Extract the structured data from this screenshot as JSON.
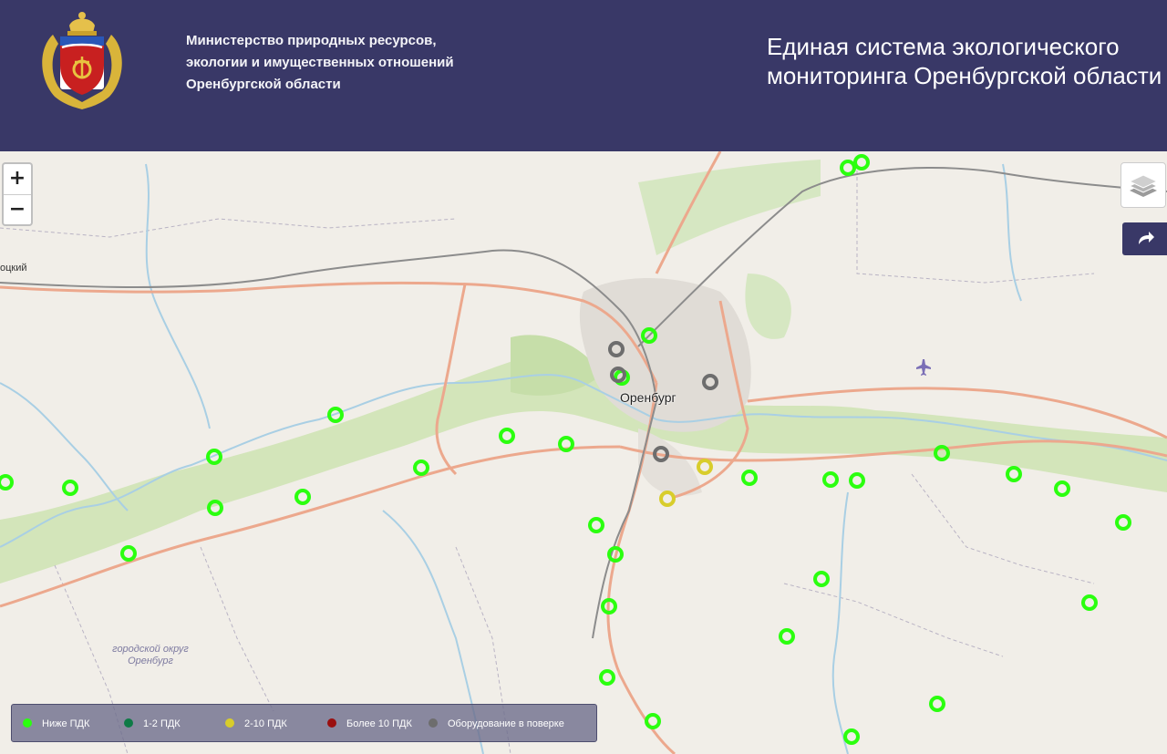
{
  "header": {
    "ministry_line1": "Министерство природных ресурсов,",
    "ministry_line2": "экологии и имущественных отношений",
    "ministry_line3": "Оренбургской области",
    "title_line1": "Единая система экологического",
    "title_line2": "мониторинга Оренбургской области"
  },
  "map": {
    "city_label": "Оренбург",
    "edge_label": "оцкий",
    "district_label": "городской округ Оренбург",
    "zoom_in": "+",
    "zoom_out": "−"
  },
  "legend": {
    "below_pdk": "Ниже ПДК",
    "pdk_1_2": "1-2 ПДК",
    "pdk_2_10": "2-10 ПДК",
    "above_10": "Более 10 ПДК",
    "equipment_check": "Оборудование в поверке"
  },
  "colors": {
    "header_bg": "#393867",
    "below_pdk": "#2bff0f",
    "pdk_1_2": "#0e7a46",
    "pdk_2_10": "#d8cd2b",
    "above_10": "#9a0f0f",
    "equipment_check": "#6d6d6d"
  },
  "icons": {
    "layers": "layers-icon",
    "share": "share-icon",
    "airport": "airplane-icon"
  }
}
